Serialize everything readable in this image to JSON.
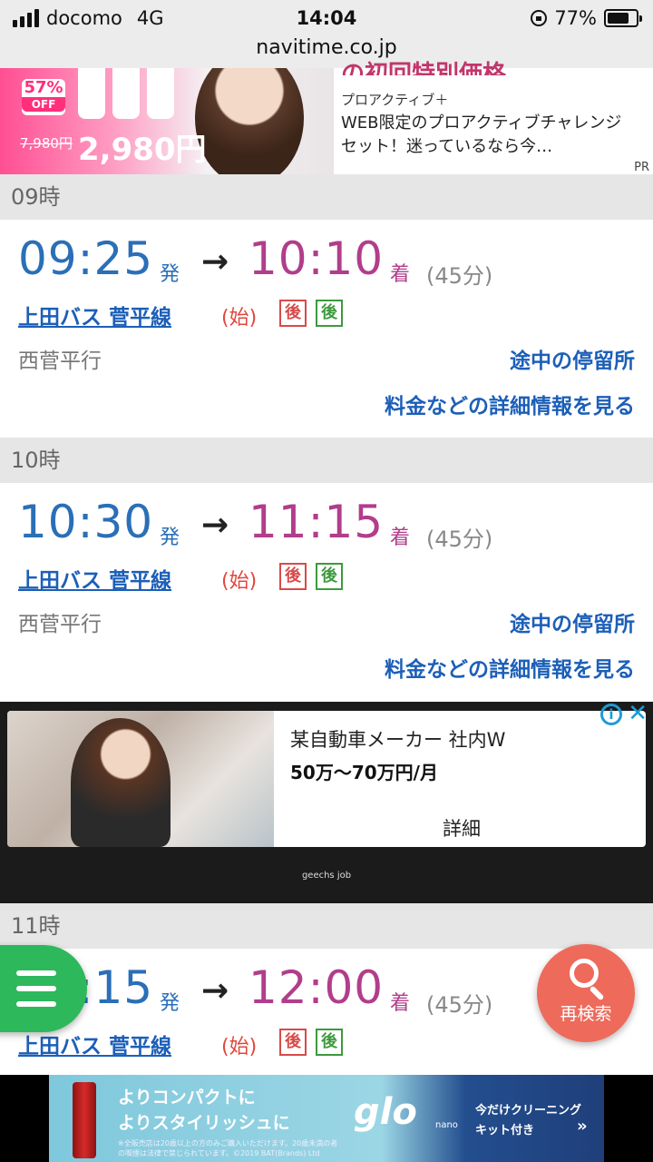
{
  "status_bar": {
    "carrier": "docomo",
    "network": "4G",
    "time": "14:04",
    "battery": "77%",
    "battery_level": 0.77,
    "url": "navitime.co.jp"
  },
  "top_ad": {
    "headline": "の初回特別価格",
    "discount": "57%",
    "discount_off": "OFF",
    "old_price": "7,980円",
    "new_price": "2,980円",
    "brand": "プロアクティブ＋",
    "description": "WEB限定のプロアクティブチャレンジセット！迷っているなら今…",
    "pr_label": "PR"
  },
  "schedule": [
    {
      "hour": "09時",
      "departure": "09:25",
      "dep_label": "発",
      "arrow": "→",
      "arrival": "10:10",
      "arr_label": "着",
      "duration": "(45分)",
      "route": "上田バス 菅平線",
      "origin_tag": "(始)",
      "tag1": "後",
      "tag2": "後",
      "destination": "西菅平行",
      "stops_link": "途中の停留所",
      "detail_link": "料金などの詳細情報を見る"
    },
    {
      "hour": "10時",
      "departure": "10:30",
      "dep_label": "発",
      "arrow": "→",
      "arrival": "11:15",
      "arr_label": "着",
      "duration": "(45分)",
      "route": "上田バス 菅平線",
      "origin_tag": "(始)",
      "tag1": "後",
      "tag2": "後",
      "destination": "西菅平行",
      "stops_link": "途中の停留所",
      "detail_link": "料金などの詳細情報を見る"
    },
    {
      "hour": "11時",
      "departure": "11:15",
      "dep_label": "発",
      "arrow": "→",
      "arrival": "12:00",
      "arr_label": "着",
      "duration": "(45分)",
      "route": "上田バス 菅平線",
      "origin_tag": "(始)",
      "tag1": "後",
      "tag2": "後"
    }
  ],
  "mid_ad": {
    "title": "某自動車メーカー 社内W",
    "salary": "50万～70万円/月",
    "detail": "詳細",
    "brand": "geechs job",
    "info_icon": "ⓘ",
    "close_icon": "✕"
  },
  "fab": {
    "search_label": "再検索"
  },
  "bottom_ad": {
    "line1": "よりコンパクトに",
    "line2": "よりスタイリッシュに",
    "small_print": "※全販売店は20歳以上の方のみご購入いただけます。20歳未満の者の喫煙は法律で禁じられています。©2019 BAT(Brands) Ltd",
    "logo": "glo",
    "logo_sub": "nano",
    "right1": "今だけクリーニング",
    "right2": "キット付き",
    "chevron": "»"
  }
}
